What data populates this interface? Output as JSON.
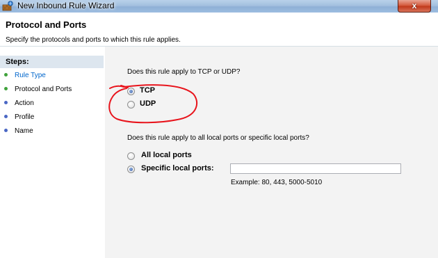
{
  "window": {
    "title": "New Inbound Rule Wizard",
    "close_glyph": "x"
  },
  "header": {
    "title": "Protocol and Ports",
    "subtitle": "Specify the protocols and ports to which this rule applies."
  },
  "steps": {
    "title": "Steps:",
    "items": [
      {
        "label": "Rule Type",
        "link": true
      },
      {
        "label": "Protocol and Ports",
        "link": false
      },
      {
        "label": "Action",
        "link": false
      },
      {
        "label": "Profile",
        "link": false
      },
      {
        "label": "Name",
        "link": false
      }
    ],
    "dot_color_done": "#3fa23b",
    "dot_color_pending": "#4a67c4"
  },
  "protocol": {
    "question": "Does this rule apply to TCP or UDP?",
    "options": [
      {
        "label": "TCP",
        "selected": true
      },
      {
        "label": "UDP",
        "selected": false
      }
    ]
  },
  "ports": {
    "question": "Does this rule apply to all local ports or specific local ports?",
    "options": [
      {
        "label": "All local ports",
        "selected": false
      },
      {
        "label": "Specific local ports:",
        "selected": true
      }
    ],
    "input_value": "",
    "example": "Example: 80, 443, 5000-5010"
  },
  "colors": {
    "annotation": "#e8141c",
    "link": "#0066cc"
  },
  "icons": {
    "title_icon": "firewall-wizard-icon",
    "close": "close-icon"
  }
}
